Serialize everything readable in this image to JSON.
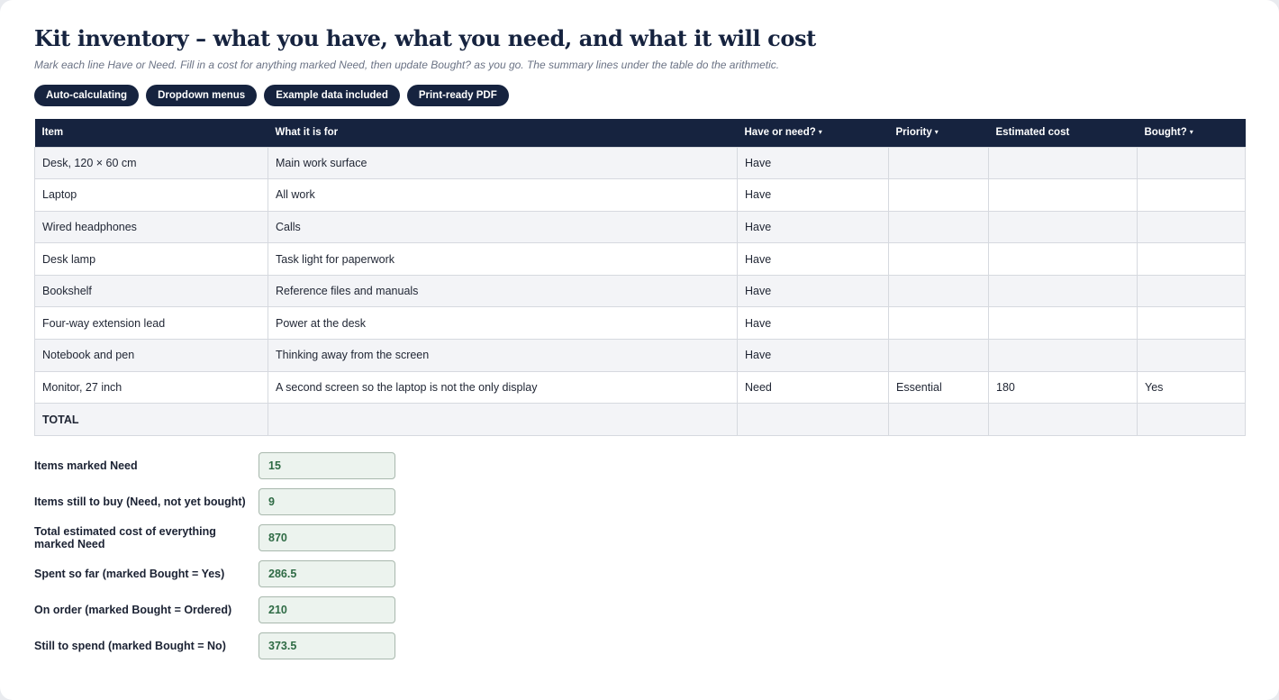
{
  "page": {
    "title": "Kit inventory – what you have, what you need, and what it will cost",
    "subtitle": "Mark each line Have or Need. Fill in a cost for anything marked Need, then update Bought? as you go. The summary lines under the table do the arithmetic."
  },
  "badges": [
    "Auto-calculating",
    "Dropdown menus",
    "Example data included",
    "Print-ready PDF"
  ],
  "table": {
    "headers": {
      "item": "Item",
      "purpose": "What it is for",
      "status": "Have or need?",
      "priority": "Priority",
      "cost": "Estimated cost",
      "bought": "Bought?"
    },
    "dropdown_caret": "▾",
    "rows": [
      [
        "Desk, 120 × 60 cm",
        "Main work surface",
        "Have",
        "",
        "",
        ""
      ],
      [
        "Laptop",
        "All work",
        "Have",
        "",
        "",
        ""
      ],
      [
        "Wired headphones",
        "Calls",
        "Have",
        "",
        "",
        ""
      ],
      [
        "Desk lamp",
        "Task light for paperwork",
        "Have",
        "",
        "",
        ""
      ],
      [
        "Bookshelf",
        "Reference files and manuals",
        "Have",
        "",
        "",
        ""
      ],
      [
        "Four-way extension lead",
        "Power at the desk",
        "Have",
        "",
        "",
        ""
      ],
      [
        "Notebook and pen",
        "Thinking away from the screen",
        "Have",
        "",
        "",
        ""
      ],
      [
        "Monitor, 27 inch",
        "A second screen so the laptop is not the only display",
        "Need",
        "Essential",
        "180",
        "Yes"
      ]
    ],
    "total_label": "TOTAL"
  },
  "summary": {
    "need_count": {
      "label": "Items marked Need",
      "value": "15"
    },
    "still_to_buy": {
      "label": "Items still to buy (Need, not yet bought)",
      "value": "9"
    },
    "total_cost": {
      "label": "Total estimated cost of everything marked Need",
      "value": "870"
    },
    "spent": {
      "label": "Spent so far (marked Bought = Yes)",
      "value": "286.5"
    },
    "on_order": {
      "label": "On order (marked Bought = Ordered)",
      "value": "210"
    },
    "still_to_spend": {
      "label": "Still to spend (marked Bought = No)",
      "value": "373.5"
    }
  }
}
